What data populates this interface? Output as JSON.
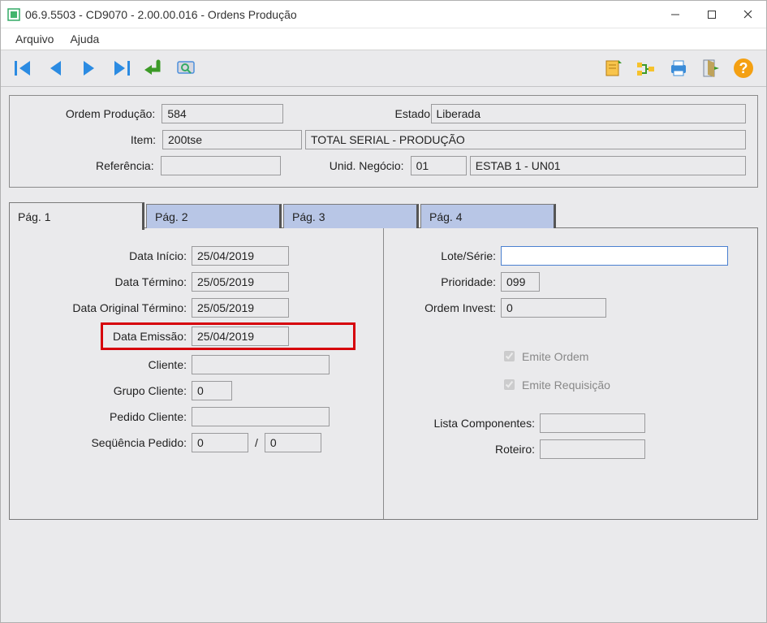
{
  "window": {
    "title": "06.9.5503 - CD9070 - 2.00.00.016 - Ordens Produção"
  },
  "menu": {
    "arquivo": "Arquivo",
    "ajuda": "Ajuda"
  },
  "header": {
    "ordem_producao_label": "Ordem Produção:",
    "ordem_producao_value": "584",
    "estado_label": "Estado:",
    "estado_value": "Liberada",
    "item_label": "Item:",
    "item_value": "200tse",
    "item_desc": "TOTAL SERIAL - PRODUÇÃO",
    "referencia_label": "Referência:",
    "referencia_value": "",
    "unid_negocio_label": "Unid. Negócio:",
    "unid_negocio_value": "01",
    "unid_negocio_desc": "ESTAB 1 - UN01"
  },
  "tabs": {
    "p1": "Pág. 1",
    "p2": "Pág. 2",
    "p3": "Pág. 3",
    "p4": "Pág. 4"
  },
  "pag1_left": {
    "data_inicio_label": "Data Início:",
    "data_inicio_value": "25/04/2019",
    "data_termino_label": "Data Término:",
    "data_termino_value": "25/05/2019",
    "data_original_termino_label": "Data Original Término:",
    "data_original_termino_value": "25/05/2019",
    "data_emissao_label": "Data Emissão:",
    "data_emissao_value": "25/04/2019",
    "cliente_label": "Cliente:",
    "cliente_value": "",
    "grupo_cliente_label": "Grupo Cliente:",
    "grupo_cliente_value": "0",
    "pedido_cliente_label": "Pedido Cliente:",
    "pedido_cliente_value": "",
    "seq_pedido_label": "Seqüência Pedido:",
    "seq_pedido_val1": "0",
    "seq_pedido_sep": "/",
    "seq_pedido_val2": "0"
  },
  "pag1_right": {
    "lote_serie_label": "Lote/Série:",
    "lote_serie_value": "",
    "prioridade_label": "Prioridade:",
    "prioridade_value": "099",
    "ordem_invest_label": "Ordem Invest:",
    "ordem_invest_value": "0",
    "emite_ordem_label": "Emite Ordem",
    "emite_requisicao_label": "Emite Requisição",
    "lista_componentes_label": "Lista Componentes:",
    "lista_componentes_value": "",
    "roteiro_label": "Roteiro:",
    "roteiro_value": ""
  }
}
